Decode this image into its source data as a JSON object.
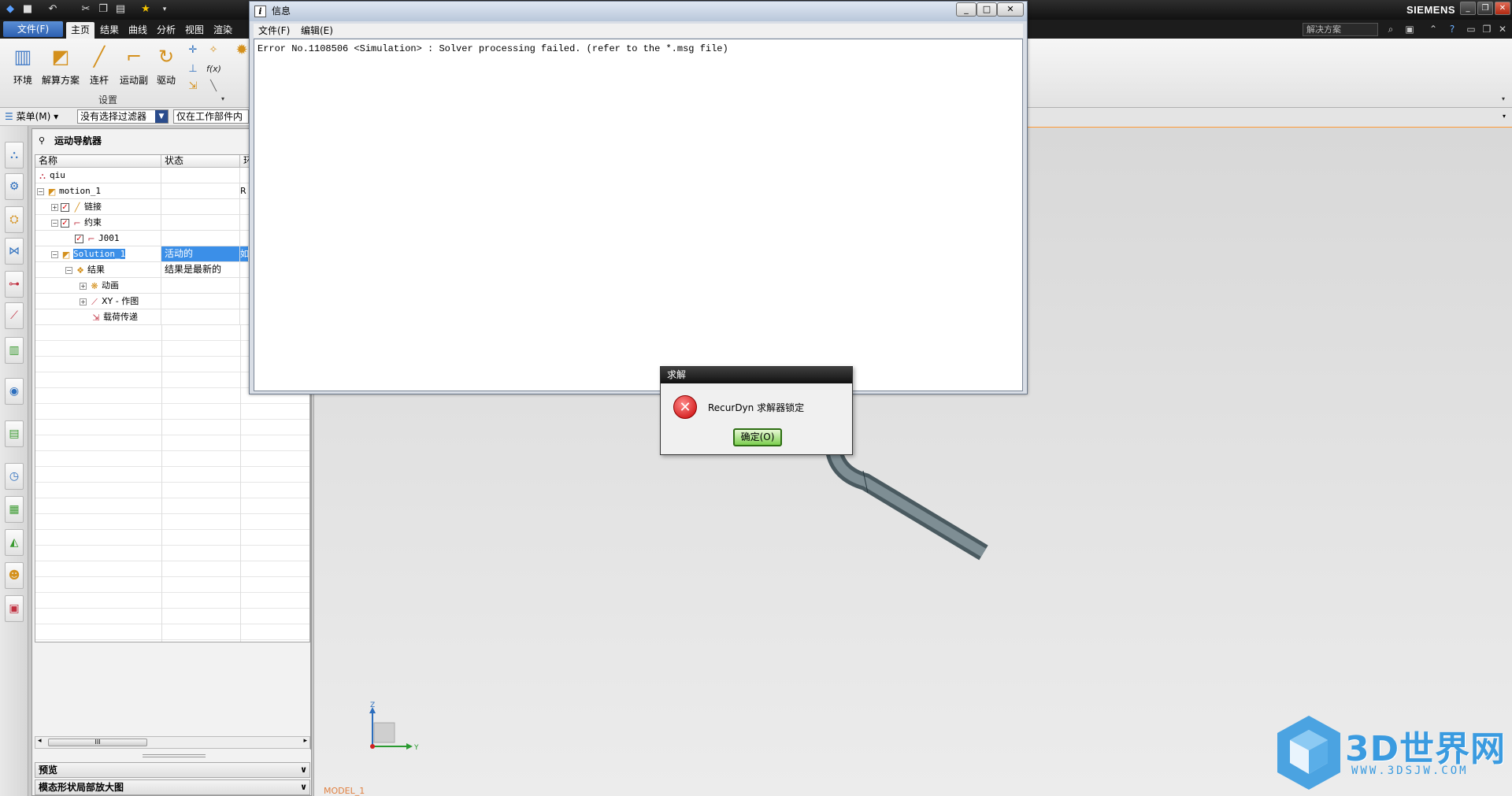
{
  "titlebar": {
    "brand": "SIEMENS",
    "quick_icons": [
      "nx-logo-icon",
      "save-icon",
      "undo-icon",
      "redo-icon",
      "cut-icon",
      "copy-icon",
      "paste-icon",
      "star-icon",
      "dropdown-icon"
    ]
  },
  "ribbon_tabs": {
    "file": "文件(F)",
    "tabs": [
      "主页",
      "结果",
      "曲线",
      "分析",
      "视图",
      "渲染"
    ],
    "active": "主页"
  },
  "search": {
    "placeholder": "解决方案"
  },
  "ribbon": {
    "buttons": [
      {
        "label": "环境",
        "icon": "environment-icon"
      },
      {
        "label": "解算方案",
        "icon": "solution-icon"
      },
      {
        "label": "连杆",
        "icon": "link-icon"
      },
      {
        "label": "运动副",
        "icon": "joint-icon"
      },
      {
        "label": "驱动",
        "icon": "driver-icon"
      }
    ],
    "group_label": "设置",
    "small_fx": "f(x)"
  },
  "filterbar": {
    "menu": "菜单(M)",
    "filter": "没有选择过滤器",
    "scope": "仅在工作部件内"
  },
  "navigator": {
    "title": "运动导航器",
    "columns": [
      "名称",
      "状态",
      "环"
    ],
    "rows": [
      {
        "name": "qiu",
        "status": "",
        "extra": ""
      },
      {
        "name": "motion_1",
        "status": "",
        "extra": "R"
      },
      {
        "name": "链接",
        "status": "",
        "extra": ""
      },
      {
        "name": "约束",
        "status": "",
        "extra": ""
      },
      {
        "name": "J001",
        "status": "",
        "extra": ""
      },
      {
        "name": "Solution_1",
        "status": "活动的",
        "extra": "如"
      },
      {
        "name": "结果",
        "status": "结果是最新的",
        "extra": ""
      },
      {
        "name": "动画",
        "status": "",
        "extra": ""
      },
      {
        "name": "XY - 作图",
        "status": "",
        "extra": ""
      },
      {
        "name": "载荷传递",
        "status": "",
        "extra": ""
      }
    ],
    "scroll_grip": "III",
    "panels": [
      "预览",
      "模态形状局部放大图"
    ]
  },
  "info_window": {
    "title": "信息",
    "menu": [
      "文件(F)",
      "编辑(E)"
    ],
    "content": "Error No.1108506 <Simulation> : Solver processing failed. (refer to the *.msg file)"
  },
  "dialog": {
    "title": "求解",
    "message": "RecurDyn 求解器锁定",
    "ok": "确定(O)"
  },
  "viewport": {
    "model_label": "MODEL_1",
    "axis_z": "Z",
    "axis_y": "Y"
  },
  "logo": {
    "text": "3D世界网",
    "url": "WWW.3DSJW.COM"
  },
  "colors": {
    "selection": "#3b8fe8",
    "ribbon_tab_bg": "#1c1c1c",
    "ok_button": "#7ccf4f",
    "error": "#c80000",
    "logo_blue": "#3a9be0"
  }
}
